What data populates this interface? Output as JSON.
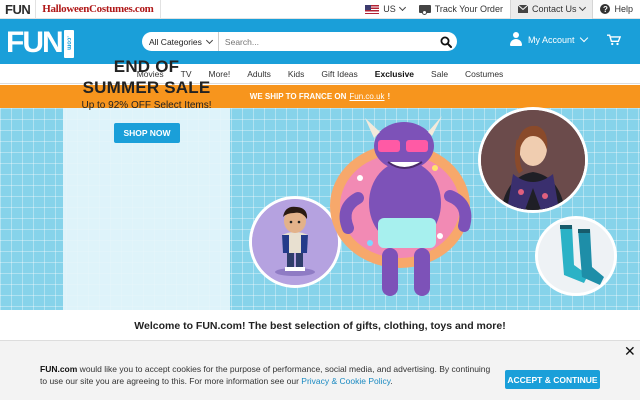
{
  "topbar": {
    "brand_fun": "FUN",
    "brand_halloween": "HalloweenCostumes.com",
    "country": "US",
    "track_order": "Track Your Order",
    "contact": "Contact Us",
    "help": "Help"
  },
  "header": {
    "logo_text": "FUN",
    "logo_suffix": ".com",
    "search_category": "All Categories",
    "search_placeholder": "Search...",
    "account_label": "My Account"
  },
  "nav": {
    "items": [
      "Movies",
      "TV",
      "More!",
      "Adults",
      "Kids",
      "Gift Ideas",
      "Exclusive",
      "Sale",
      "Costumes"
    ]
  },
  "ship_banner": {
    "text": "WE SHIP TO FRANCE ON",
    "link": "Fun.co.uk",
    "suffix": "!"
  },
  "hero": {
    "title_line1": "END OF",
    "title_line2": "SUMMER SALE",
    "subtitle": "Up to 92% OFF Select Items!",
    "cta": "SHOP NOW"
  },
  "welcome": {
    "text": "Welcome to FUN.com! The best selection of gifts, clothing, toys and more!"
  },
  "cookie": {
    "brand": "FUN.com",
    "text_part1": " would like you to accept cookies for the purpose of performance, social media, and advertising. By continuing to use our site you are agreeing to this. For more information see our ",
    "policy_link": "Privacy & Cookie Policy",
    "text_part2": ".",
    "accept": "ACCEPT & CONTINUE",
    "close": "✕"
  },
  "colors": {
    "brand_blue": "#1a9fd9",
    "ship_orange": "#f7951d",
    "pool_blue": "#86d3ea"
  },
  "icons": [
    "us-flag-icon",
    "truck-icon",
    "mail-icon",
    "help-icon",
    "search-icon",
    "user-icon",
    "cart-icon",
    "close-icon"
  ]
}
